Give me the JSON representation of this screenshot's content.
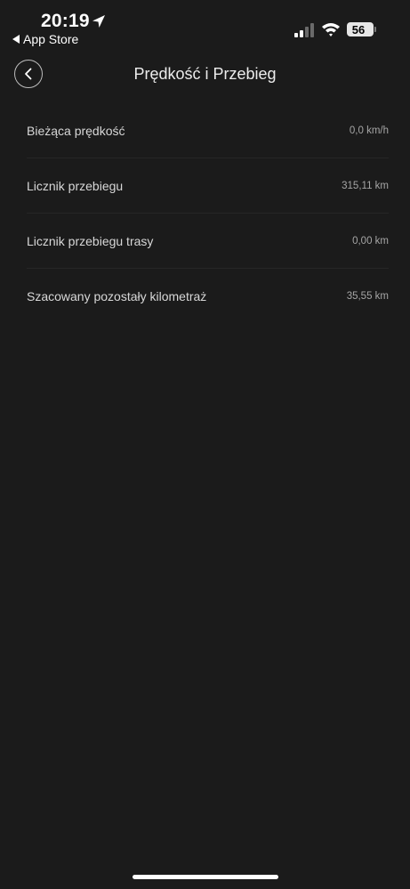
{
  "status_bar": {
    "time": "20:19",
    "back_app": "App Store",
    "battery": "56"
  },
  "nav": {
    "title": "Prędkość i Przebieg"
  },
  "rows": [
    {
      "label": "Bieżąca prędkość",
      "value": "0,0 km/h"
    },
    {
      "label": "Licznik przebiegu",
      "value": "315,11 km"
    },
    {
      "label": "Licznik przebiegu trasy",
      "value": "0,00 km"
    },
    {
      "label": "Szacowany pozostały kilometraż",
      "value": "35,55 km"
    }
  ],
  "colors": {
    "background": "#1b1b1b",
    "text": "#e6e6e6",
    "secondary": "#a5a5a5"
  }
}
